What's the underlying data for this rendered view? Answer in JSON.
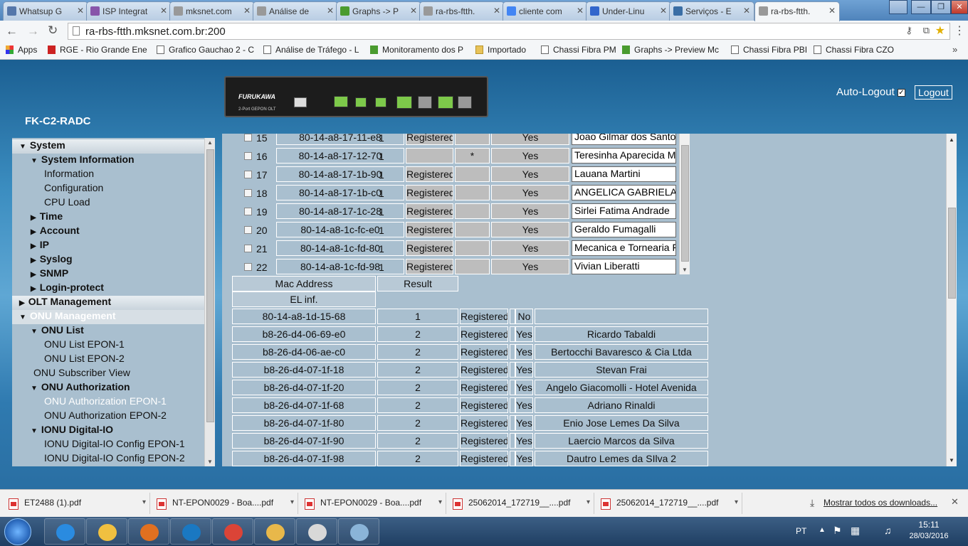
{
  "tabs": [
    {
      "label": "Whatsup G",
      "icon": "whatsup-icon",
      "color": "#5577aa"
    },
    {
      "label": "ISP Integrat",
      "icon": "isp-icon",
      "color": "#8855aa"
    },
    {
      "label": "mksnet.com",
      "icon": "page-icon",
      "color": "#999999"
    },
    {
      "label": "Análise de",
      "icon": "page-icon",
      "color": "#999999"
    },
    {
      "label": "Graphs -> P",
      "icon": "graphs-icon",
      "color": "#4a9b2f"
    },
    {
      "label": "ra-rbs-ftth.",
      "icon": "page-icon",
      "color": "#999999"
    },
    {
      "label": "cliente com",
      "icon": "google-icon",
      "color": "#4285f4"
    },
    {
      "label": "Under-Linu",
      "icon": "under-linux-icon",
      "color": "#3366cc"
    },
    {
      "label": "Serviços - E",
      "icon": "servicos-icon",
      "color": "#3a6ea5"
    },
    {
      "label": "ra-rbs-ftth.",
      "icon": "page-icon",
      "color": "#999999",
      "active": true
    }
  ],
  "window": {
    "minimize": "—",
    "maximize": "❐",
    "close": "✕"
  },
  "nav": {
    "url": "ra-rbs-ftth.mksnet.com.br:200"
  },
  "bookmarks": [
    "Apps",
    "RGE - Rio Grande Ene",
    "Grafico Gauchao 2 - C",
    "Análise de Tráfego - L",
    "Monitoramento dos P",
    "Importado",
    "Chassi Fibra PM",
    "Graphs -> Preview Mc",
    "Chassi Fibra PBI",
    "Chassi Fibra CZO"
  ],
  "header": {
    "device_brand": "FURUKAWA",
    "device_model": "2-Port GEPON OLT",
    "hostname": "FK-C2-RADC",
    "autologout_label": "Auto-Logout",
    "autologout_checked": true,
    "logout_label": "Logout"
  },
  "tree": [
    {
      "label": "System",
      "level": 0,
      "arrow": "▼",
      "style": "hdr"
    },
    {
      "label": "System Information",
      "level": 1,
      "arrow": "▼",
      "bold": true
    },
    {
      "label": "Information",
      "level": 2
    },
    {
      "label": "Configuration",
      "level": 2
    },
    {
      "label": "CPU Load",
      "level": 2
    },
    {
      "label": "Time",
      "level": 1,
      "arrow": "▶",
      "bold": true
    },
    {
      "label": "Account",
      "level": 1,
      "arrow": "▶",
      "bold": true
    },
    {
      "label": "IP",
      "level": 1,
      "arrow": "▶",
      "bold": true
    },
    {
      "label": "Syslog",
      "level": 1,
      "arrow": "▶",
      "bold": true
    },
    {
      "label": "SNMP",
      "level": 1,
      "arrow": "▶",
      "bold": true
    },
    {
      "label": "Login-protect",
      "level": 1,
      "arrow": "▶",
      "bold": true
    },
    {
      "label": "OLT Management",
      "level": 0,
      "arrow": "▶",
      "style": "hdr"
    },
    {
      "label": "ONU Management",
      "level": 0,
      "arrow": "▼",
      "style": "hdr2"
    },
    {
      "label": "ONU List",
      "level": 1,
      "arrow": "▼",
      "bold": true
    },
    {
      "label": "ONU List EPON-1",
      "level": 2
    },
    {
      "label": "ONU List EPON-2",
      "level": 2
    },
    {
      "label": "ONU Subscriber View",
      "level": 1.5
    },
    {
      "label": "ONU Authorization",
      "level": 1,
      "arrow": "▼",
      "bold": true
    },
    {
      "label": "ONU Authorization EPON-1",
      "level": 2,
      "selected": true
    },
    {
      "label": "ONU Authorization EPON-2",
      "level": 2
    },
    {
      "label": "IONU Digital-IO",
      "level": 1,
      "arrow": "▼",
      "bold": true
    },
    {
      "label": "IONU Digital-IO Config EPON-1",
      "level": 2
    },
    {
      "label": "IONU Digital-IO Config EPON-2",
      "level": 2
    }
  ],
  "auth_table": [
    {
      "num": "15",
      "mac": "80-14-a8-17-11-e8",
      "llid": "1",
      "status": "Registered",
      "flag": "",
      "enabled": "Yes",
      "name": "Joao Gilmar dos Santos"
    },
    {
      "num": "16",
      "mac": "80-14-a8-17-12-70",
      "llid": "1",
      "status": "",
      "flag": "*",
      "enabled": "Yes",
      "name": "Teresinha Aparecida Ma"
    },
    {
      "num": "17",
      "mac": "80-14-a8-17-1b-90",
      "llid": "1",
      "status": "Registered",
      "flag": "",
      "enabled": "Yes",
      "name": "Lauana Martini"
    },
    {
      "num": "18",
      "mac": "80-14-a8-17-1b-c0",
      "llid": "1",
      "status": "Registered",
      "flag": "",
      "enabled": "Yes",
      "name": "ANGELICA GABRIELA"
    },
    {
      "num": "19",
      "mac": "80-14-a8-17-1c-28",
      "llid": "1",
      "status": "Registered",
      "flag": "",
      "enabled": "Yes",
      "name": "Sirlei Fatima Andrade"
    },
    {
      "num": "20",
      "mac": "80-14-a8-1c-fc-e0",
      "llid": "1",
      "status": "Registered",
      "flag": "",
      "enabled": "Yes",
      "name": "Geraldo Fumagalli"
    },
    {
      "num": "21",
      "mac": "80-14-a8-1c-fd-80",
      "llid": "1",
      "status": "Registered",
      "flag": "",
      "enabled": "Yes",
      "name": "Mecanica e Tornearia Fc"
    },
    {
      "num": "22",
      "mac": "80-14-a8-1c-fd-98",
      "llid": "1",
      "status": "Registered",
      "flag": "",
      "enabled": "Yes",
      "name": "Vivian Liberatti"
    }
  ],
  "result_headers": {
    "mac": "Mac Address",
    "result": "Result",
    "el": "EL inf."
  },
  "result_table": [
    {
      "mac": "80-14-a8-1d-15-68",
      "port": "1",
      "status": "Registered",
      "auth": "No",
      "name": ""
    },
    {
      "mac": "b8-26-d4-06-69-e0",
      "port": "2",
      "status": "Registered",
      "auth": "Yes",
      "name": "Ricardo Tabaldi"
    },
    {
      "mac": "b8-26-d4-06-ae-c0",
      "port": "2",
      "status": "Registered",
      "auth": "Yes",
      "name": "Bertocchi Bavaresco & Cia Ltda"
    },
    {
      "mac": "b8-26-d4-07-1f-18",
      "port": "2",
      "status": "Registered",
      "auth": "Yes",
      "name": "Stevan Frai"
    },
    {
      "mac": "b8-26-d4-07-1f-20",
      "port": "2",
      "status": "Registered",
      "auth": "Yes",
      "name": "Angelo Giacomolli - Hotel Avenida"
    },
    {
      "mac": "b8-26-d4-07-1f-68",
      "port": "2",
      "status": "Registered",
      "auth": "Yes",
      "name": "Adriano Rinaldi"
    },
    {
      "mac": "b8-26-d4-07-1f-80",
      "port": "2",
      "status": "Registered",
      "auth": "Yes",
      "name": "Enio Jose Lemes Da Silva"
    },
    {
      "mac": "b8-26-d4-07-1f-90",
      "port": "2",
      "status": "Registered",
      "auth": "Yes",
      "name": "Laercio Marcos da Silva"
    },
    {
      "mac": "b8-26-d4-07-1f-98",
      "port": "2",
      "status": "Registered",
      "auth": "Yes",
      "name": "Dautro Lemes da SIlva 2"
    }
  ],
  "downloads": [
    "ET2488 (1).pdf",
    "NT-EPON0029 - Boa....pdf",
    "NT-EPON0029 - Boa....pdf",
    "25062014_172719__....pdf",
    "25062014_172719__....pdf"
  ],
  "show_all_downloads": "Mostrar todos os downloads...",
  "taskbar": {
    "lang": "PT",
    "time": "15:11",
    "date": "28/03/2016",
    "apps": [
      {
        "name": "ie-icon",
        "color": "#2a8be0"
      },
      {
        "name": "explorer-icon",
        "color": "#f0c040"
      },
      {
        "name": "media-player-icon",
        "color": "#e07020"
      },
      {
        "name": "skype-icon",
        "color": "#1a78c2"
      },
      {
        "name": "chrome-icon",
        "color": "#db4437"
      },
      {
        "name": "outlook-icon",
        "color": "#e8b84a"
      },
      {
        "name": "slack-icon",
        "color": "#d8d8d8"
      },
      {
        "name": "notepad-icon",
        "color": "#8ab4d8"
      }
    ]
  }
}
